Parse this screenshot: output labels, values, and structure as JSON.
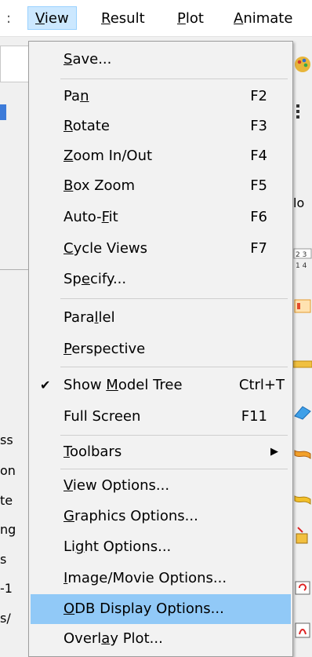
{
  "menubar": {
    "items": [
      {
        "id": "prev",
        "label": ":"
      },
      {
        "id": "view",
        "label": "View",
        "mn": "V",
        "rest": "iew"
      },
      {
        "id": "result",
        "label": "Result",
        "mn": "R",
        "rest": "esult"
      },
      {
        "id": "plot",
        "label": "Plot",
        "mn": "P",
        "rest": "lot"
      },
      {
        "id": "animate",
        "label": "Animate",
        "mn": "A",
        "rest": "nimate"
      }
    ]
  },
  "background": {
    "right_text": "lo",
    "toolbar_nums": [
      "2 3",
      "1 4"
    ],
    "left_fragments": [
      "ss",
      "on",
      "te",
      "ng",
      "s",
      "-1",
      "s/"
    ]
  },
  "menu": {
    "items": [
      {
        "id": "save",
        "pre": "",
        "mn": "S",
        "post": "ave...",
        "shortcut": ""
      },
      {
        "id": "pan",
        "pre": "Pa",
        "mn": "n",
        "post": "",
        "shortcut": "F2"
      },
      {
        "id": "rotate",
        "pre": "",
        "mn": "R",
        "post": "otate",
        "shortcut": "F3"
      },
      {
        "id": "zoom",
        "pre": "",
        "mn": "Z",
        "post": "oom In/Out",
        "shortcut": "F4"
      },
      {
        "id": "box-zoom",
        "pre": "",
        "mn": "B",
        "post": "ox Zoom",
        "shortcut": "F5"
      },
      {
        "id": "auto-fit",
        "pre": "Auto-",
        "mn": "F",
        "post": "it",
        "shortcut": "F6"
      },
      {
        "id": "cycle-views",
        "pre": "",
        "mn": "C",
        "post": "ycle Views",
        "shortcut": "F7"
      },
      {
        "id": "specify",
        "pre": "Sp",
        "mn": "e",
        "post": "cify...",
        "shortcut": ""
      },
      {
        "id": "parallel",
        "pre": "Para",
        "mn": "l",
        "post": "lel",
        "shortcut": ""
      },
      {
        "id": "perspective",
        "pre": "",
        "mn": "P",
        "post": "erspective",
        "shortcut": ""
      },
      {
        "id": "show-model-tree",
        "pre": "Show ",
        "mn": "M",
        "post": "odel Tree",
        "shortcut": "Ctrl+T",
        "checked": "✔"
      },
      {
        "id": "full-screen",
        "pre": "Full Screen",
        "mn": "",
        "post": "",
        "shortcut": "F11"
      },
      {
        "id": "toolbars",
        "pre": "",
        "mn": "T",
        "post": "oolbars",
        "shortcut": "",
        "submenu": "▶"
      },
      {
        "id": "view-options",
        "pre": "",
        "mn": "V",
        "post": "iew Options...",
        "shortcut": ""
      },
      {
        "id": "graphics-options",
        "pre": "",
        "mn": "G",
        "post": "raphics Options...",
        "shortcut": ""
      },
      {
        "id": "light-options",
        "pre": "Li",
        "mn": "g",
        "post": "ht Options...",
        "shortcut": ""
      },
      {
        "id": "image-movie-options",
        "pre": "",
        "mn": "I",
        "post": "mage/Movie Options...",
        "shortcut": ""
      },
      {
        "id": "odb-display-options",
        "pre": "",
        "mn": "O",
        "post": "DB Display Options...",
        "shortcut": "",
        "highlighted": true
      },
      {
        "id": "overlay-plot",
        "pre": "Overl",
        "mn": "a",
        "post": "y Plot...",
        "shortcut": ""
      }
    ]
  },
  "colors": {
    "menu_bg": "#f2f2f2",
    "highlight": "#91c9f7",
    "menubar_open": "#cce8ff"
  }
}
